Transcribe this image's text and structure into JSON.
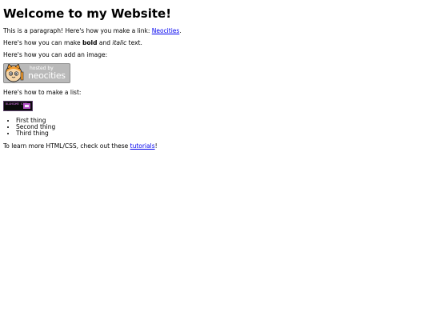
{
  "heading": "Welcome to my Website!",
  "p1": {
    "before": "This is a paragraph! Here's how you make a link: ",
    "link": "Neocities",
    "after": "."
  },
  "p2": {
    "before": "Here's how you can make ",
    "bold": "bold",
    "middle": " and ",
    "italic": "italic",
    "after": " text."
  },
  "p3": "Here's how you can add an image:",
  "badge": {
    "small": "hosted by",
    "big": "neocities",
    "icon": "cat-mascot-icon"
  },
  "p4": "Here's how to make a list:",
  "pixel_button": {
    "text": "BLAHSOME SITE",
    "icon": "window-icon"
  },
  "list": [
    "First thing",
    "Second thing",
    "Third thing"
  ],
  "p5": {
    "before": "To learn more HTML/CSS, check out these ",
    "link": "tutorials",
    "after": "!"
  },
  "colors": {
    "link": "#0000ee",
    "badge_bg": "#b9b9b9",
    "pixel_bg": "#0a0a0a",
    "pixel_accent": "#b44fc8"
  }
}
